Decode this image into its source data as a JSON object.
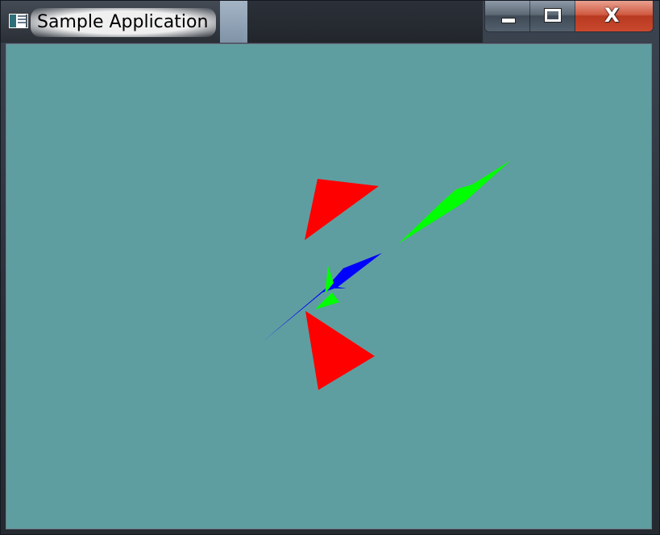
{
  "window": {
    "title": "Sample Application",
    "icon": "app-window-icon",
    "controls": {
      "minimize_icon": "minimize-icon",
      "maximize_icon": "maximize-icon",
      "close_icon": "close-icon",
      "close_glyph": "X"
    }
  },
  "viewport": {
    "background_color": "#5f9ea0",
    "shape_colors": {
      "red": "#ff0000",
      "green": "#00ff00",
      "blue": "#0000ff"
    }
  }
}
